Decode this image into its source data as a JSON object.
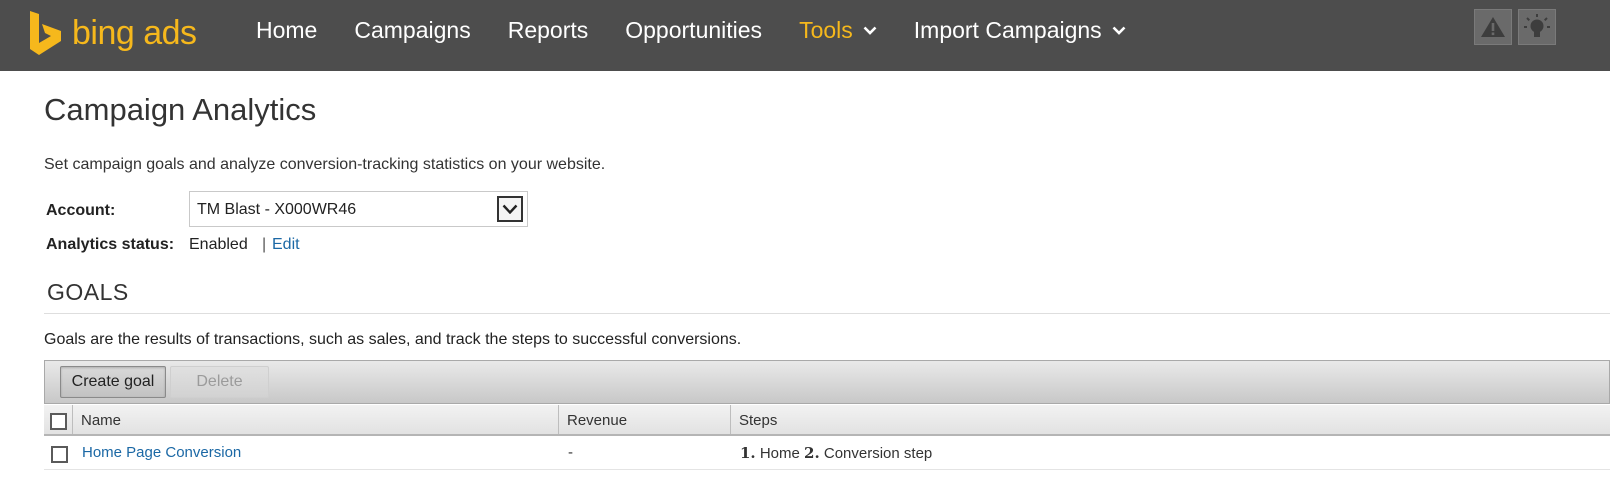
{
  "brand": {
    "name": "bing ads",
    "accent": "#f6b81c",
    "topbar_bg": "#4d4d4d"
  },
  "nav": {
    "items": [
      {
        "label": "Home",
        "active": false,
        "dropdown": false
      },
      {
        "label": "Campaigns",
        "active": false,
        "dropdown": false
      },
      {
        "label": "Reports",
        "active": false,
        "dropdown": false
      },
      {
        "label": "Opportunities",
        "active": false,
        "dropdown": false
      },
      {
        "label": "Tools",
        "active": true,
        "dropdown": true
      },
      {
        "label": "Import Campaigns",
        "active": false,
        "dropdown": true
      }
    ],
    "right_icons": [
      "warning-icon",
      "lightbulb-icon"
    ]
  },
  "page": {
    "title": "Campaign Analytics",
    "description": "Set campaign goals and analyze conversion-tracking statistics on your website."
  },
  "account": {
    "label": "Account:",
    "selected": "TM Blast - X000WR46"
  },
  "analytics": {
    "label": "Analytics status:",
    "value": "Enabled",
    "separator": "|",
    "edit_label": "Edit"
  },
  "goals": {
    "heading": "GOALS",
    "description": "Goals are the results of transactions, such as sales, and track the steps to successful conversions.",
    "toolbar": {
      "create_label": "Create goal",
      "delete_label": "Delete"
    },
    "columns": [
      "Name",
      "Revenue",
      "Steps"
    ],
    "rows": [
      {
        "name": "Home Page Conversion",
        "revenue": "-",
        "steps": [
          {
            "num": "1.",
            "label": "Home"
          },
          {
            "num": "2.",
            "label": "Conversion step"
          }
        ]
      }
    ]
  }
}
